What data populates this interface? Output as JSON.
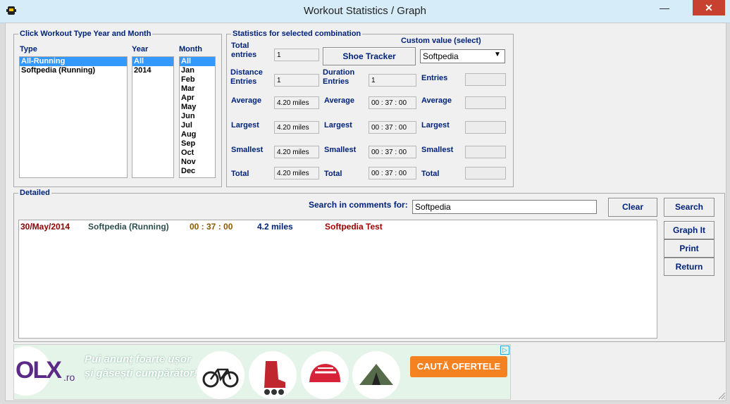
{
  "window": {
    "title": "Workout Statistics / Graph",
    "minimize": "—",
    "close": "✕"
  },
  "selection": {
    "legend": "Click Workout Type Year and Month",
    "type_header": "Type",
    "year_header": "Year",
    "month_header": "Month",
    "types": [
      "All-Running",
      "Softpedia (Running)"
    ],
    "selected_type": "All-Running",
    "years": [
      "All",
      "2014"
    ],
    "selected_year": "All",
    "months": [
      "All",
      "Jan",
      "Feb",
      "Mar",
      "Apr",
      "May",
      "Jun",
      "Jul",
      "Aug",
      "Sep",
      "Oct",
      "Nov",
      "Dec"
    ],
    "selected_month": "All"
  },
  "stats": {
    "legend": "Statistics for selected combination",
    "total_entries_label": "Total entries",
    "total_entries_value": "1",
    "shoe_tracker_label": "Shoe Tracker",
    "custom_value_label": "Custom value (select)",
    "custom_value_selected": "Softpedia",
    "distance_entries_label": "Distance Entries",
    "distance_entries_value": "1",
    "duration_entries_label": "Duration Entries",
    "duration_entries_value": "1",
    "custom_entries_label": "Entries",
    "average_label": "Average",
    "largest_label": "Largest",
    "smallest_label": "Smallest",
    "total_label": "Total",
    "distance": {
      "average": "4.20 miles",
      "largest": "4.20 miles",
      "smallest": "4.20 miles",
      "total": "4.20 miles"
    },
    "duration": {
      "average": "00 : 37 : 00",
      "largest": "00 : 37 : 00",
      "smallest": "00 : 37 : 00",
      "total": "00 : 37 : 00"
    }
  },
  "detailed": {
    "legend": "Detailed",
    "search_label": "Search in comments for:",
    "search_value": "Softpedia",
    "clear_label": "Clear",
    "search_button": "Search",
    "rows": [
      {
        "date": "30/May/2014",
        "type": "Softpedia (Running)",
        "duration": "00 : 37 : 00",
        "distance": "4.2 miles",
        "comment": "Softpedia Test"
      }
    ]
  },
  "actions": {
    "graph": "Graph It",
    "print": "Print",
    "return": "Return"
  },
  "ad": {
    "logo": "OLX",
    "logo_tld": ".ro",
    "tagline_1": "Pui anunț foarte ușor",
    "tagline_2": "și găsești cumpărător!",
    "cta": "CAUTĂ OFERTELE",
    "colors": {
      "olx_purple": "#5b2a86",
      "olx_blue": "#1ea4d9",
      "olx_green": "#7ac143",
      "olx_orange": "#f7941d",
      "cta": "#f58220"
    }
  },
  "colors": {
    "label_navy": "#00227a",
    "date_red": "#8b0000",
    "type_teal": "#2f4f4f",
    "duration_brown": "#8b5a00",
    "distance_navy": "#00227a",
    "comment_red": "#a00000"
  }
}
